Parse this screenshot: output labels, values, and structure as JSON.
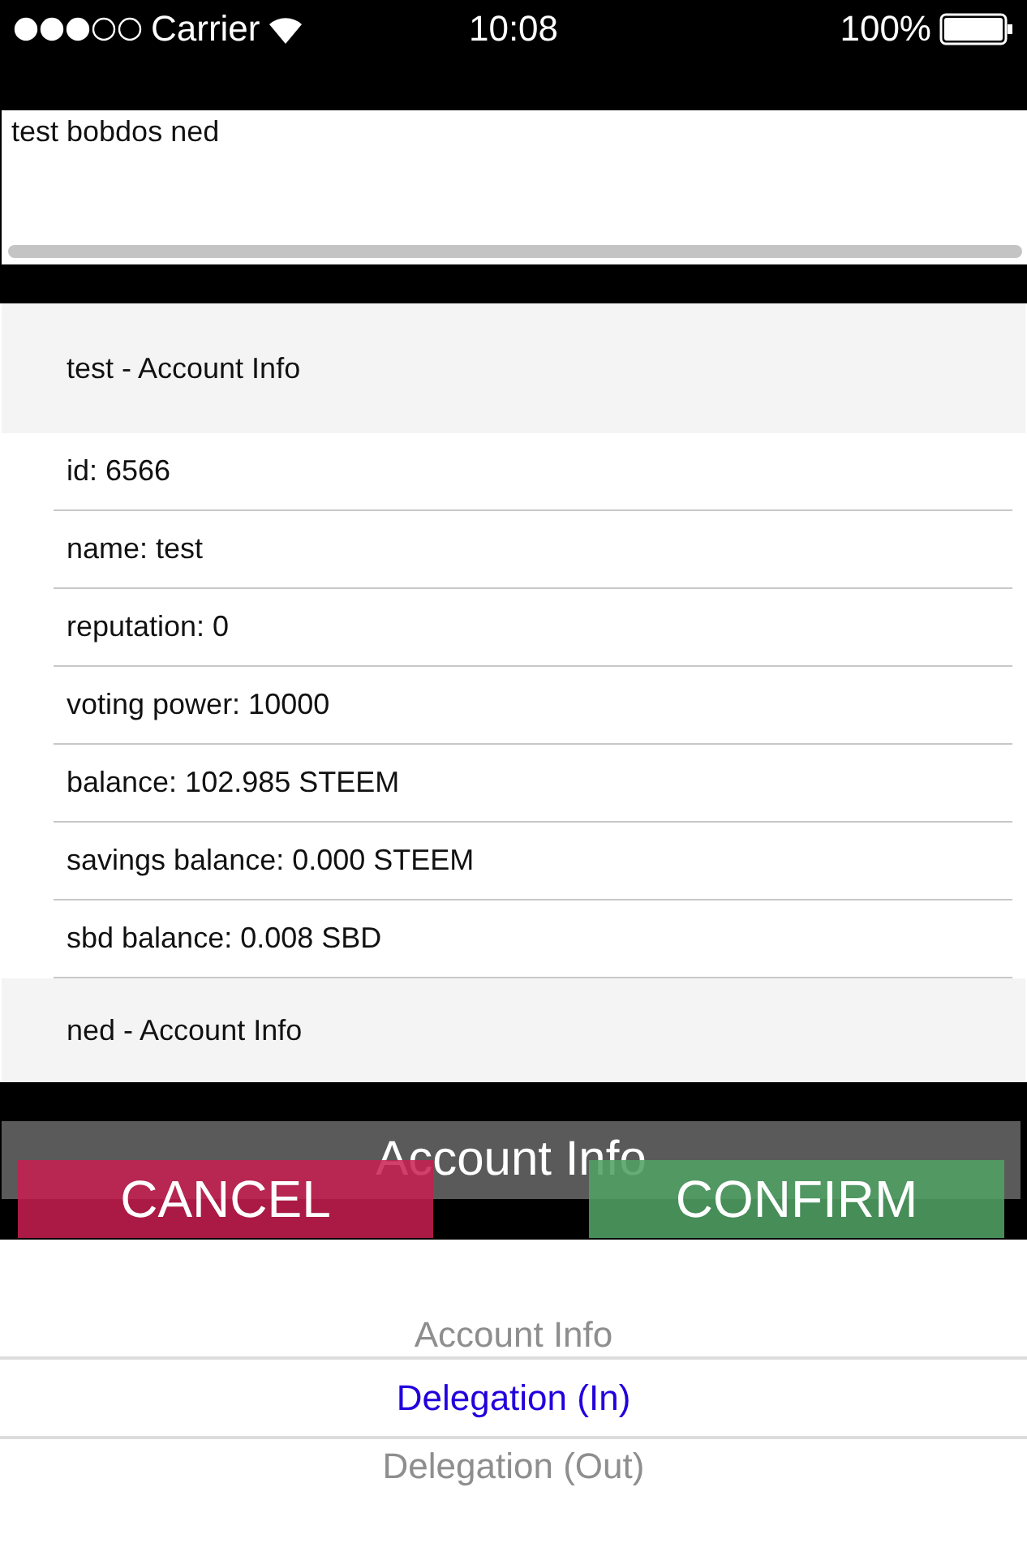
{
  "status_bar": {
    "carrier": "Carrier",
    "time": "10:08",
    "battery": "100%"
  },
  "text_area": {
    "value": "test bobdos ned"
  },
  "accounts": [
    {
      "title": "test - Account Info",
      "fields": [
        "id: 6566",
        "name: test",
        "reputation: 0",
        "voting power: 10000",
        "balance: 102.985 STEEM",
        "savings balance: 0.000 STEEM",
        "sbd balance: 0.008 SBD"
      ]
    },
    {
      "title": "ned - Account Info"
    }
  ],
  "picker_bar": {
    "title": "Account Info"
  },
  "buttons": [
    {
      "label": "CANCEL",
      "kind": "cancel"
    },
    {
      "label": "CONFIRM",
      "kind": "confirm"
    }
  ],
  "picker": [
    {
      "label": "Account Info",
      "selected": false
    },
    {
      "label": "Delegation (In)",
      "selected": true
    },
    {
      "label": "Delegation (Out)",
      "selected": false
    }
  ]
}
